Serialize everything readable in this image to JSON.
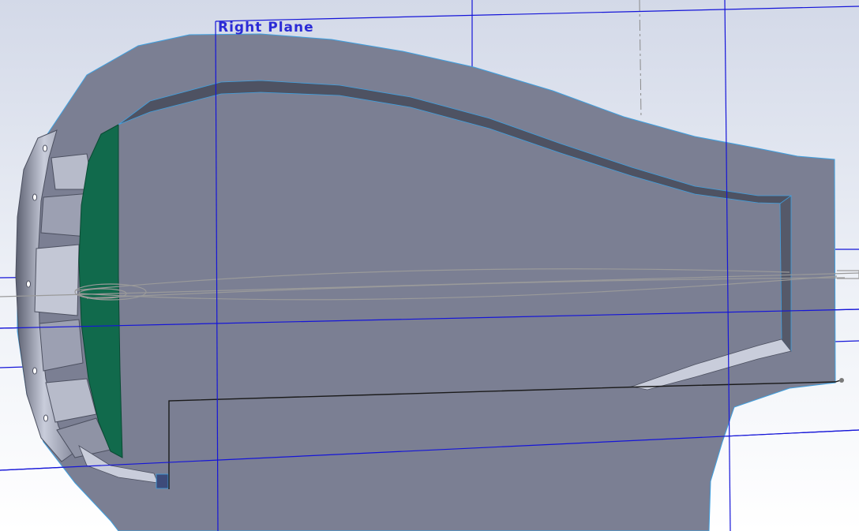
{
  "viewport": {
    "plane_label": "Right Plane",
    "colors": {
      "background_top": "#d3d9e8",
      "background_bottom": "#ffffff",
      "plane_line": "#1515d8",
      "body_face": "#7b7f93",
      "body_edge": "#4c5060",
      "edge_highlight": "#3fa0e0",
      "bore_face": "#116a4c",
      "flange_light": "#c9cddb",
      "sketch_line": "#9a9a9a"
    }
  }
}
